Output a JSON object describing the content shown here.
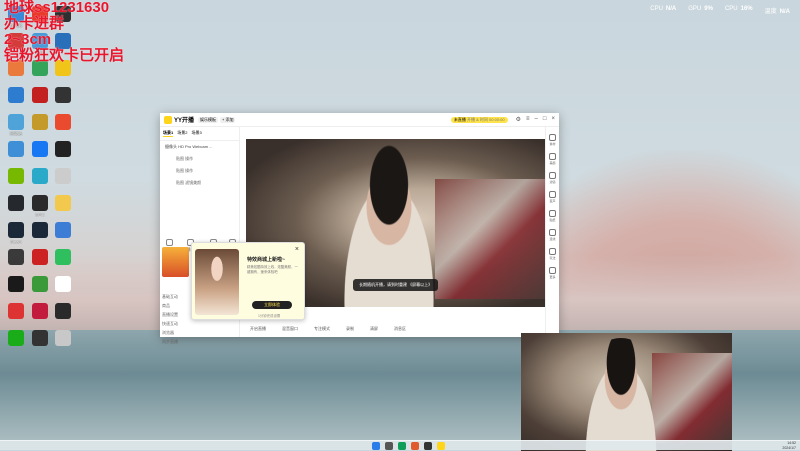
{
  "overlay": {
    "line1": "地球ss1231630",
    "line2": "办卡进群",
    "line3": "2~3cm",
    "line4": "铠粉狂欢卡已开启"
  },
  "system_monitor": [
    {
      "label": "CPU",
      "value": "N/A"
    },
    {
      "label": "GPU",
      "value": "9%"
    },
    {
      "label": "CPU",
      "value": "16%"
    },
    {
      "label": "温度",
      "value": "N/A"
    }
  ],
  "desktop_icons": [
    {
      "label": "此电脑",
      "color": "#3a8ad8"
    },
    {
      "label": "",
      "color": "#e8392a"
    },
    {
      "label": "",
      "color": "#2f2f2f"
    },
    {
      "label": "",
      "color": "#d43b3b"
    },
    {
      "label": "网络",
      "color": "#4b9ad8"
    },
    {
      "label": "",
      "color": "#2a6fb9"
    },
    {
      "label": "",
      "color": "#ea7a3c"
    },
    {
      "label": "",
      "color": "#35a45b"
    },
    {
      "label": "",
      "color": "#f0c419"
    },
    {
      "label": "",
      "color": "#2e7ccf"
    },
    {
      "label": "",
      "color": "#c32020"
    },
    {
      "label": "",
      "color": "#333333"
    },
    {
      "label": "回收站",
      "color": "#4fa3d9"
    },
    {
      "label": "",
      "color": "#c49a2a"
    },
    {
      "label": "",
      "color": "#ea4a2e"
    },
    {
      "label": "",
      "color": "#3e8fd6"
    },
    {
      "label": "",
      "color": "#1877f2"
    },
    {
      "label": "",
      "color": "#222222"
    },
    {
      "label": "",
      "color": "#76b900"
    },
    {
      "label": "",
      "color": "#2aa9c9"
    },
    {
      "label": "",
      "color": "#cccccc"
    },
    {
      "label": "",
      "color": "#25292e"
    },
    {
      "label": "EPIC",
      "color": "#2a2a2a"
    },
    {
      "label": "",
      "color": "#f2c94c"
    },
    {
      "label": "Steam",
      "color": "#1b2838"
    },
    {
      "label": "",
      "color": "#1b2838"
    },
    {
      "label": "",
      "color": "#3e7dd6"
    },
    {
      "label": "",
      "color": "#3a3a3a"
    },
    {
      "label": "",
      "color": "#cc2222"
    },
    {
      "label": "",
      "color": "#2fbf5f"
    },
    {
      "label": "",
      "color": "#1a1a1a"
    },
    {
      "label": "",
      "color": "#3a9a3a"
    },
    {
      "label": "",
      "color": "#ffffff"
    },
    {
      "label": "",
      "color": "#d33"
    },
    {
      "label": "",
      "color": "#c21b3e"
    },
    {
      "label": "",
      "color": "#2a2a2a"
    },
    {
      "label": "",
      "color": "#1aad19"
    },
    {
      "label": "",
      "color": "#333333"
    },
    {
      "label": "",
      "color": "#c8c8c8"
    }
  ],
  "yy": {
    "brand": "YY开播",
    "tag1": "娱乐模板",
    "tag2": "+ 添加",
    "live_btn": "未直播",
    "live_hint": "开播 & 时间 00:00:00",
    "tabs": [
      "场景1",
      "场景2",
      "场景3"
    ],
    "sources": [
      {
        "label": "摄像头 HD Pro Webcam ...",
        "sub": false
      },
      {
        "label": "贴图 操作",
        "sub": true
      },
      {
        "label": "贴图 操作",
        "sub": true
      },
      {
        "label": "贴图 滤镜美颜",
        "sub": true
      }
    ],
    "left_tools": [
      "摄像头",
      "场景模板",
      "去除效果",
      "添加"
    ],
    "left_bottom": [
      "基础互动",
      "商品",
      "直播设置",
      "快速互动",
      "浏览器",
      "同步直播"
    ],
    "toast": "长期随机开播，请到时重建 《屏幕以上》",
    "right_tools": [
      "素材",
      "美颜",
      "滤镜",
      "变声",
      "贴纸",
      "连线",
      "玩法",
      "更多",
      "团战",
      "特效"
    ],
    "bottom_tools": [
      "开启直播",
      "混音窗口",
      "专注模式",
      "录制",
      "清屏",
      "消息区"
    ]
  },
  "popup": {
    "close": "×",
    "title": "特效商城上新啦~",
    "desc": "精美炫酷特效上线，炫酷美颜、一键拥有，速来体验吧",
    "button": "立即体验",
    "sub": "1分钟完成设置"
  },
  "taskbar": {
    "time": "14:52",
    "date": "2024/1/7",
    "lang": "中"
  }
}
